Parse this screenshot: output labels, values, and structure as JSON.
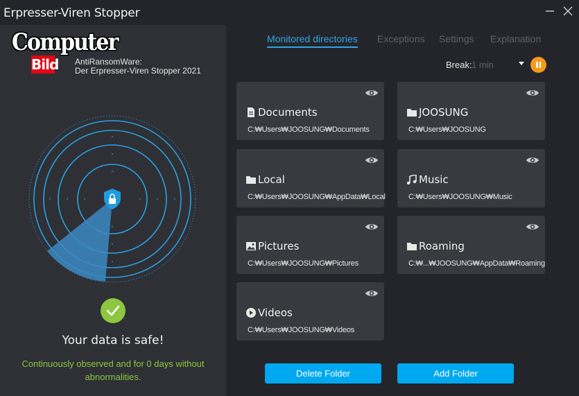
{
  "window": {
    "title": "Erpresser-Viren Stopper"
  },
  "brand": {
    "logo_text": "Computer",
    "logo_sub": "Bild",
    "product_line1": "AntiRansomWare:",
    "product_line2": "Der Erpresser-Viren Stopper 2021"
  },
  "status": {
    "headline": "Your data is safe!",
    "note": "Continuously observed and for 0 days without abnormalities.",
    "ok_color": "#8dc63f"
  },
  "tabs": [
    {
      "label": "Monitored directories",
      "active": true
    },
    {
      "label": "Exceptions",
      "active": false
    },
    {
      "label": "Settings",
      "active": false
    },
    {
      "label": "Explanation",
      "active": false
    }
  ],
  "break": {
    "label": "Break:",
    "selected": "1 min"
  },
  "folders": [
    {
      "name": "Documents",
      "path": "C:₩Users₩JOOSUNG₩Documents",
      "icon": "document-icon"
    },
    {
      "name": "JOOSUNG",
      "path": "C:₩Users₩JOOSUNG",
      "icon": "folder-icon"
    },
    {
      "name": "Local",
      "path": "C:₩Users₩JOOSUNG₩AppData₩Local",
      "icon": "folder-icon"
    },
    {
      "name": "Music",
      "path": "C:₩Users₩JOOSUNG₩Music",
      "icon": "music-icon"
    },
    {
      "name": "Pictures",
      "path": "C:₩Users₩JOOSUNG₩Pictures",
      "icon": "image-icon"
    },
    {
      "name": "Roaming",
      "path": "C:₩...₩JOOSUNG₩AppData₩Roaming",
      "icon": "folder-icon"
    },
    {
      "name": "Videos",
      "path": "C:₩Users₩JOOSUNG₩Videos",
      "icon": "play-icon"
    }
  ],
  "buttons": {
    "delete": "Delete Folder",
    "add": "Add Folder"
  },
  "colors": {
    "accent": "#2ea6e6",
    "button": "#00a8f0",
    "pause": "#f59a1b",
    "danger_logo": "#e30613"
  }
}
